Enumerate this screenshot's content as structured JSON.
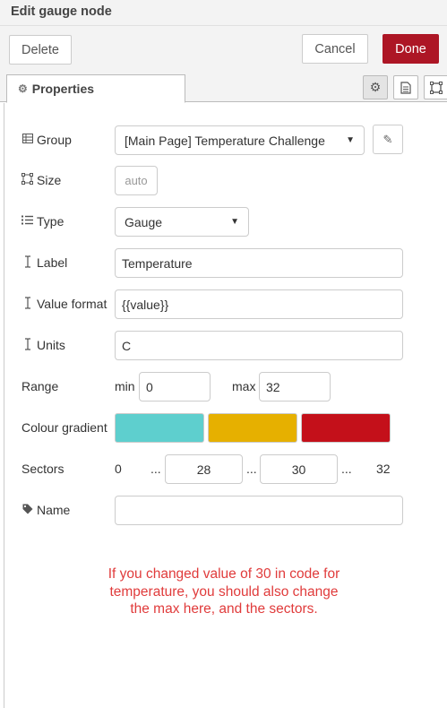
{
  "header": {
    "title": "Edit gauge node"
  },
  "buttons": {
    "delete": "Delete",
    "cancel": "Cancel",
    "done": "Done",
    "done_color": "#ad1625"
  },
  "tabs": {
    "properties": "Properties",
    "icons": [
      "gear-icon",
      "description-icon",
      "appearance-icon"
    ]
  },
  "form": {
    "group": {
      "label": "Group",
      "value": "[Main Page] Temperature Challenge"
    },
    "size": {
      "label": "Size",
      "value": "auto"
    },
    "type": {
      "label": "Type",
      "value": "Gauge"
    },
    "label": {
      "label": "Label",
      "value": "Temperature"
    },
    "value_format": {
      "label": "Value format",
      "value": "{{value}}"
    },
    "units": {
      "label": "Units",
      "value": "C"
    },
    "range": {
      "label": "Range",
      "min_label": "min",
      "min": "0",
      "max_label": "max",
      "max": "32"
    },
    "colour_gradient": {
      "label": "Colour gradient",
      "colors": [
        "#5ecfce",
        "#e6b000",
        "#c4101a"
      ]
    },
    "sectors": {
      "label": "Sectors",
      "start": "0",
      "sep": "...",
      "first": "28",
      "second": "30",
      "end": "32"
    },
    "name": {
      "label": "Name",
      "value": ""
    }
  },
  "note": {
    "lines": [
      "If you changed value of 30 in code for",
      "temperature, you should also change",
      "the max here, and the sectors."
    ],
    "color": "#e03b3b"
  }
}
